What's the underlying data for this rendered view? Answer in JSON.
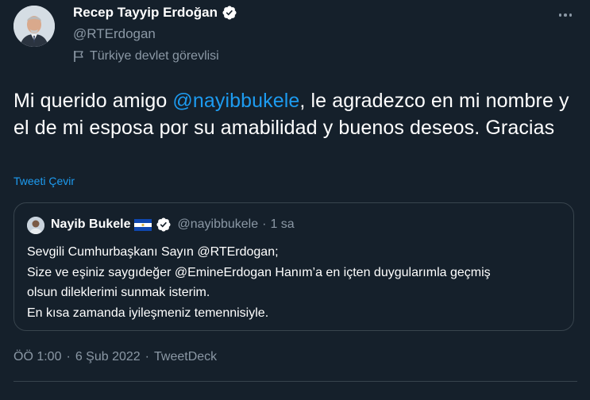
{
  "author": {
    "name": "Recep Tayyip Erdoğan",
    "handle": "@RTErdogan",
    "label": "Türkiye devlet görevlisi",
    "verified_icon": "verified-badge-icon"
  },
  "tweet": {
    "text_before": "Mi querido amigo ",
    "mention": "@nayibbukele",
    "text_after": ", le agradezco en mi nombre y el de mi esposa por su amabilidad y buenos deseos. Gracias",
    "translate_label": "Tweeti Çevir"
  },
  "quote": {
    "name": "Nayib Bukele",
    "flag_icon": "el-salvador-flag-icon",
    "handle": "@nayibbukele",
    "dot": "·",
    "time": "1 sa",
    "lines": [
      "Sevgili Cumhurbaşkanı Sayın @RTErdogan;",
      "Size ve eşiniz saygıdeğer @EmineErdogan Hanım’a en içten duygularımla geçmiş",
      "olsun dileklerimi sunmak isterim.",
      "En kısa zamanda iyileşmeniz temennisiyle."
    ]
  },
  "meta": {
    "time": "ÖÖ 1:00",
    "dot1": "·",
    "date": "6 Şub 2022",
    "dot2": "·",
    "source": "TweetDeck"
  },
  "colors": {
    "background": "#15202b",
    "accent": "#1d9bf0",
    "secondary_text": "#8b98a5",
    "border": "#38444d"
  }
}
